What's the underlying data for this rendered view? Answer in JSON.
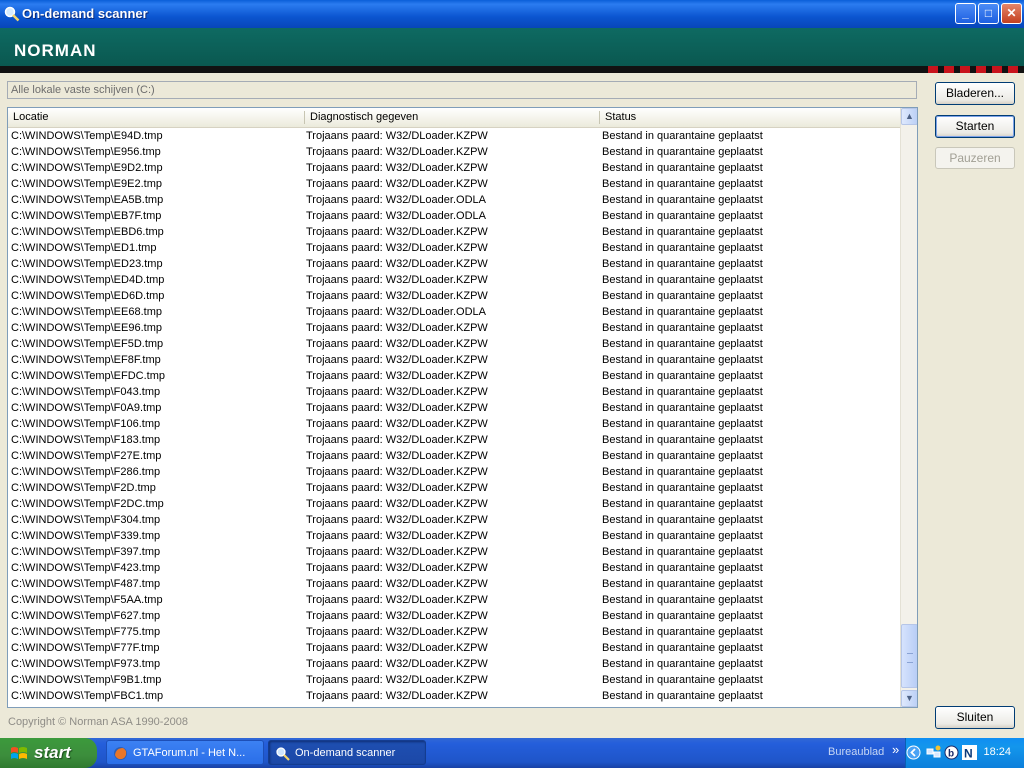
{
  "window": {
    "title": "On-demand scanner",
    "brand": "NORMAN",
    "controls": {
      "minimize": "_",
      "maximize": "□",
      "close": "✕"
    }
  },
  "scan_target": {
    "value": "Alle lokale vaste schijven (C:)"
  },
  "buttons": {
    "browse": "Bladeren...",
    "start": "Starten",
    "pause": "Pauzeren",
    "close": "Sluiten"
  },
  "table": {
    "columns": [
      "Locatie",
      "Diagnostisch gegeven",
      "Status"
    ],
    "rows": [
      [
        "C:\\WINDOWS\\Temp\\E94D.tmp",
        "Trojaans paard: W32/DLoader.KZPW",
        "Bestand in quarantaine geplaatst"
      ],
      [
        "C:\\WINDOWS\\Temp\\E956.tmp",
        "Trojaans paard: W32/DLoader.KZPW",
        "Bestand in quarantaine geplaatst"
      ],
      [
        "C:\\WINDOWS\\Temp\\E9D2.tmp",
        "Trojaans paard: W32/DLoader.KZPW",
        "Bestand in quarantaine geplaatst"
      ],
      [
        "C:\\WINDOWS\\Temp\\E9E2.tmp",
        "Trojaans paard: W32/DLoader.KZPW",
        "Bestand in quarantaine geplaatst"
      ],
      [
        "C:\\WINDOWS\\Temp\\EA5B.tmp",
        "Trojaans paard: W32/DLoader.ODLA",
        "Bestand in quarantaine geplaatst"
      ],
      [
        "C:\\WINDOWS\\Temp\\EB7F.tmp",
        "Trojaans paard: W32/DLoader.ODLA",
        "Bestand in quarantaine geplaatst"
      ],
      [
        "C:\\WINDOWS\\Temp\\EBD6.tmp",
        "Trojaans paard: W32/DLoader.KZPW",
        "Bestand in quarantaine geplaatst"
      ],
      [
        "C:\\WINDOWS\\Temp\\ED1.tmp",
        "Trojaans paard: W32/DLoader.KZPW",
        "Bestand in quarantaine geplaatst"
      ],
      [
        "C:\\WINDOWS\\Temp\\ED23.tmp",
        "Trojaans paard: W32/DLoader.KZPW",
        "Bestand in quarantaine geplaatst"
      ],
      [
        "C:\\WINDOWS\\Temp\\ED4D.tmp",
        "Trojaans paard: W32/DLoader.KZPW",
        "Bestand in quarantaine geplaatst"
      ],
      [
        "C:\\WINDOWS\\Temp\\ED6D.tmp",
        "Trojaans paard: W32/DLoader.KZPW",
        "Bestand in quarantaine geplaatst"
      ],
      [
        "C:\\WINDOWS\\Temp\\EE68.tmp",
        "Trojaans paard: W32/DLoader.ODLA",
        "Bestand in quarantaine geplaatst"
      ],
      [
        "C:\\WINDOWS\\Temp\\EE96.tmp",
        "Trojaans paard: W32/DLoader.KZPW",
        "Bestand in quarantaine geplaatst"
      ],
      [
        "C:\\WINDOWS\\Temp\\EF5D.tmp",
        "Trojaans paard: W32/DLoader.KZPW",
        "Bestand in quarantaine geplaatst"
      ],
      [
        "C:\\WINDOWS\\Temp\\EF8F.tmp",
        "Trojaans paard: W32/DLoader.KZPW",
        "Bestand in quarantaine geplaatst"
      ],
      [
        "C:\\WINDOWS\\Temp\\EFDC.tmp",
        "Trojaans paard: W32/DLoader.KZPW",
        "Bestand in quarantaine geplaatst"
      ],
      [
        "C:\\WINDOWS\\Temp\\F043.tmp",
        "Trojaans paard: W32/DLoader.KZPW",
        "Bestand in quarantaine geplaatst"
      ],
      [
        "C:\\WINDOWS\\Temp\\F0A9.tmp",
        "Trojaans paard: W32/DLoader.KZPW",
        "Bestand in quarantaine geplaatst"
      ],
      [
        "C:\\WINDOWS\\Temp\\F106.tmp",
        "Trojaans paard: W32/DLoader.KZPW",
        "Bestand in quarantaine geplaatst"
      ],
      [
        "C:\\WINDOWS\\Temp\\F183.tmp",
        "Trojaans paard: W32/DLoader.KZPW",
        "Bestand in quarantaine geplaatst"
      ],
      [
        "C:\\WINDOWS\\Temp\\F27E.tmp",
        "Trojaans paard: W32/DLoader.KZPW",
        "Bestand in quarantaine geplaatst"
      ],
      [
        "C:\\WINDOWS\\Temp\\F286.tmp",
        "Trojaans paard: W32/DLoader.KZPW",
        "Bestand in quarantaine geplaatst"
      ],
      [
        "C:\\WINDOWS\\Temp\\F2D.tmp",
        "Trojaans paard: W32/DLoader.KZPW",
        "Bestand in quarantaine geplaatst"
      ],
      [
        "C:\\WINDOWS\\Temp\\F2DC.tmp",
        "Trojaans paard: W32/DLoader.KZPW",
        "Bestand in quarantaine geplaatst"
      ],
      [
        "C:\\WINDOWS\\Temp\\F304.tmp",
        "Trojaans paard: W32/DLoader.KZPW",
        "Bestand in quarantaine geplaatst"
      ],
      [
        "C:\\WINDOWS\\Temp\\F339.tmp",
        "Trojaans paard: W32/DLoader.KZPW",
        "Bestand in quarantaine geplaatst"
      ],
      [
        "C:\\WINDOWS\\Temp\\F397.tmp",
        "Trojaans paard: W32/DLoader.KZPW",
        "Bestand in quarantaine geplaatst"
      ],
      [
        "C:\\WINDOWS\\Temp\\F423.tmp",
        "Trojaans paard: W32/DLoader.KZPW",
        "Bestand in quarantaine geplaatst"
      ],
      [
        "C:\\WINDOWS\\Temp\\F487.tmp",
        "Trojaans paard: W32/DLoader.KZPW",
        "Bestand in quarantaine geplaatst"
      ],
      [
        "C:\\WINDOWS\\Temp\\F5AA.tmp",
        "Trojaans paard: W32/DLoader.KZPW",
        "Bestand in quarantaine geplaatst"
      ],
      [
        "C:\\WINDOWS\\Temp\\F627.tmp",
        "Trojaans paard: W32/DLoader.KZPW",
        "Bestand in quarantaine geplaatst"
      ],
      [
        "C:\\WINDOWS\\Temp\\F775.tmp",
        "Trojaans paard: W32/DLoader.KZPW",
        "Bestand in quarantaine geplaatst"
      ],
      [
        "C:\\WINDOWS\\Temp\\F77F.tmp",
        "Trojaans paard: W32/DLoader.KZPW",
        "Bestand in quarantaine geplaatst"
      ],
      [
        "C:\\WINDOWS\\Temp\\F973.tmp",
        "Trojaans paard: W32/DLoader.KZPW",
        "Bestand in quarantaine geplaatst"
      ],
      [
        "C:\\WINDOWS\\Temp\\F9B1.tmp",
        "Trojaans paard: W32/DLoader.KZPW",
        "Bestand in quarantaine geplaatst"
      ],
      [
        "C:\\WINDOWS\\Temp\\FBC1.tmp",
        "Trojaans paard: W32/DLoader.KZPW",
        "Bestand in quarantaine geplaatst"
      ]
    ]
  },
  "scrollbar": {
    "up": "▲",
    "down": "▼"
  },
  "footer": {
    "copyright": "Copyright © Norman ASA 1990-2008"
  },
  "taskbar": {
    "start": "start",
    "tasks": [
      {
        "label": "GTAForum.nl - Het N...",
        "icon": "firefox-icon"
      },
      {
        "label": "On-demand scanner",
        "icon": "scanner-icon"
      }
    ],
    "desktop_label": "Bureaublad",
    "clock": "18:24"
  },
  "colors": {
    "brand_band": "#0e6a62",
    "brand_stripe": "#c8141c",
    "taskbar": "#245edb",
    "start": "#3c8d3c"
  }
}
